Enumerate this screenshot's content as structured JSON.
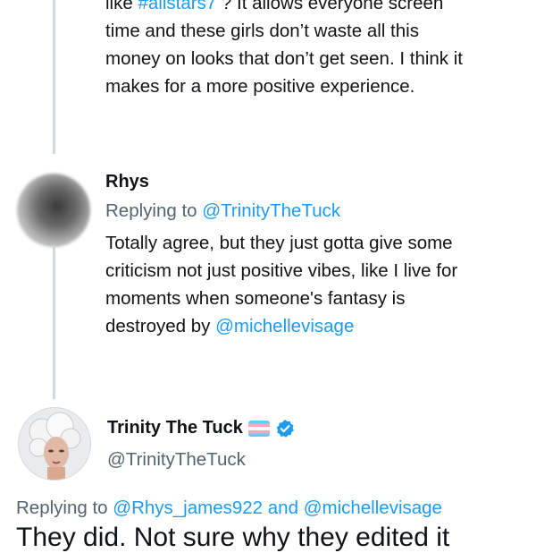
{
  "colors": {
    "accent": "#1d9bf0",
    "text": "#0f1419",
    "muted": "#536471",
    "line": "#cfd9de"
  },
  "top_tweet": {
    "line1_pre": "like ",
    "line1_hashtag": "#allstars7",
    "line1_post": " ? It allows everyone screen",
    "line2": "time and these girls don’t waste all this",
    "line3": "money on looks that don’t get seen. I think it",
    "line4": "makes for a more positive experience."
  },
  "reply_rhys": {
    "name": "Rhys",
    "replying_prefix": "Replying to",
    "replying_to": "@TrinityTheTuck",
    "body_line1": "Totally agree, but they just gotta give some",
    "body_line2": "criticism not just positive vibes, like I live for",
    "body_line3": "moments when someone's fantasy is",
    "body_line4_pre": "destroyed by ",
    "body_line4_mention": "@michellevisage"
  },
  "tweet_trinity": {
    "name": "Trinity The Tuck",
    "flag_icon": "transgender-flag-icon",
    "verified_icon": "verified-badge-icon",
    "handle": "@TrinityTheTuck",
    "replying_prefix": "Replying to",
    "mention1": "@Rhys_james922",
    "and_text": " and ",
    "mention2": "@michellevisage",
    "body_partial": "They did. Not sure why they edited it"
  }
}
